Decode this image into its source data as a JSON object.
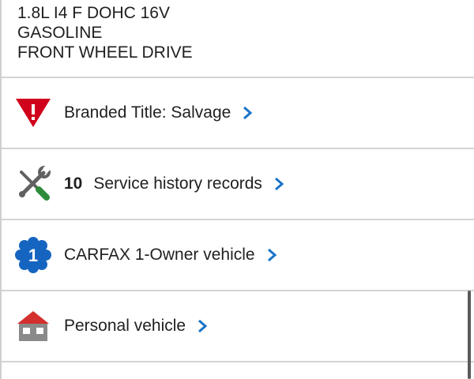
{
  "specs": {
    "engine": "1.8L I4 F DOHC 16V",
    "fuel": "GASOLINE",
    "drive": "FRONT WHEEL DRIVE"
  },
  "rows": [
    {
      "icon": "warning-triangle-icon",
      "label": "Branded Title: Salvage"
    },
    {
      "icon": "wrench-screwdriver-icon",
      "count": "10",
      "label": "Service history records"
    },
    {
      "icon": "one-owner-badge-icon",
      "badge_text": "1",
      "label": "CARFAX 1-Owner vehicle"
    },
    {
      "icon": "house-icon",
      "label": "Personal vehicle"
    }
  ],
  "colors": {
    "accent_blue": "#1a73c8",
    "warning_red": "#d0021b",
    "badge_blue": "#1565c0",
    "house_red": "#d32f2f",
    "house_gray": "#8a8a8a",
    "tool_gray": "#616161",
    "tool_green": "#2e8b3a"
  }
}
